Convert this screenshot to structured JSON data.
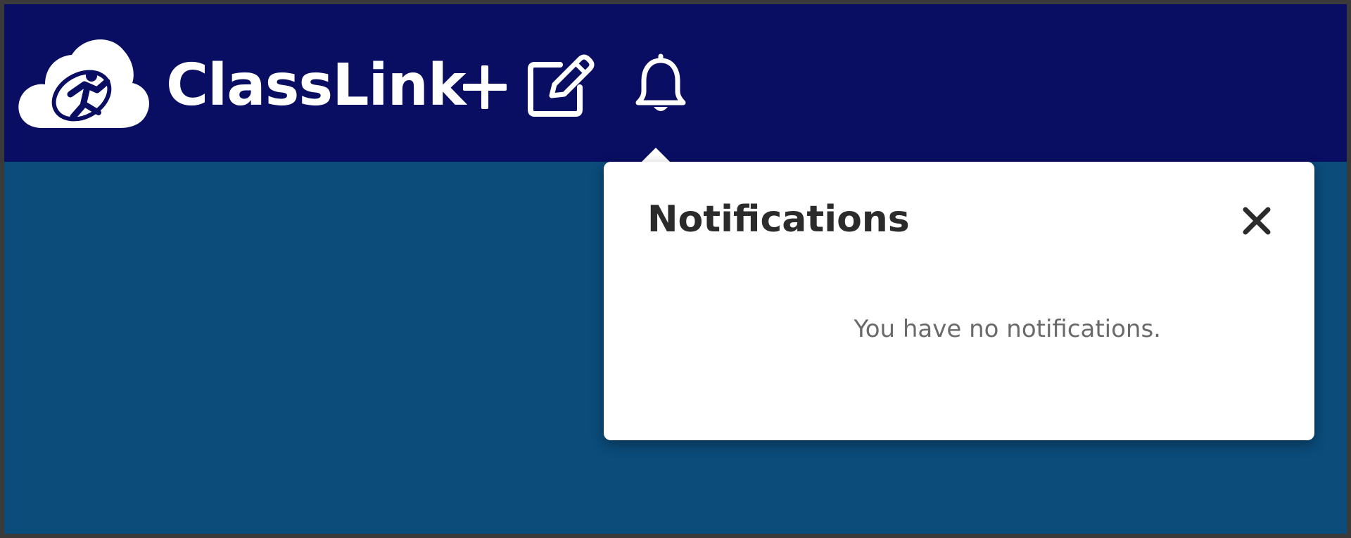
{
  "header": {
    "brand_name": "ClassLink",
    "logo_icon": "classlink-cloud-logo",
    "plus_icon": "plus-icon",
    "edit_icon": "pencil-square-icon",
    "bell_icon": "bell-icon"
  },
  "notifications": {
    "title": "Notifications",
    "empty_message": "You have no notifications.",
    "close_icon": "close-icon"
  },
  "colors": {
    "topbar": "#0a0e63",
    "main_background": "#0b4c7b",
    "popover_background": "#ffffff",
    "title_text": "#2b2b2b",
    "muted_text": "#6a6a6a"
  }
}
